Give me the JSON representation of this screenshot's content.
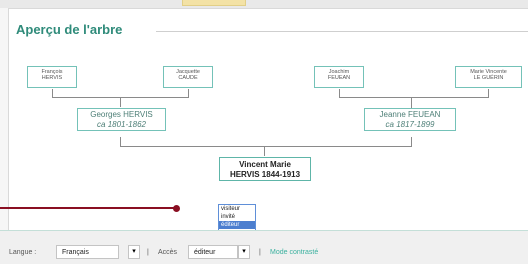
{
  "header": {
    "title": "Aperçu de l'arbre"
  },
  "tree": {
    "great_grandparents": [
      {
        "name": "François\nHERVIS"
      },
      {
        "name": "Jacquette\nCAUDE"
      },
      {
        "name": "Joachim\nFEUEAN"
      },
      {
        "name": "Marie Vincente\nLE GUÉRIN"
      }
    ],
    "parents": [
      {
        "name": "Georges HERVIS",
        "dates": "ca 1801-1862"
      },
      {
        "name": "Jeanne FEUEAN",
        "dates": "ca 1817-1899"
      }
    ],
    "subject": {
      "name": "Vincent Marie",
      "surname_dates": "HERVIS 1844-1913"
    }
  },
  "access_dropdown": {
    "options": [
      "visiteur",
      "invité",
      "éditeur"
    ],
    "selected": "éditeur"
  },
  "footer": {
    "language_label": "Langue :",
    "language_value": "Français",
    "separator": "|",
    "access_label": "Accès",
    "access_value": "éditeur",
    "contrast_link": "Mode contrasté"
  },
  "colors": {
    "accent": "#2f8b7a",
    "box_border": "#74c2b8",
    "annotation": "#8a0f22",
    "selected": "#4c7ecf"
  }
}
